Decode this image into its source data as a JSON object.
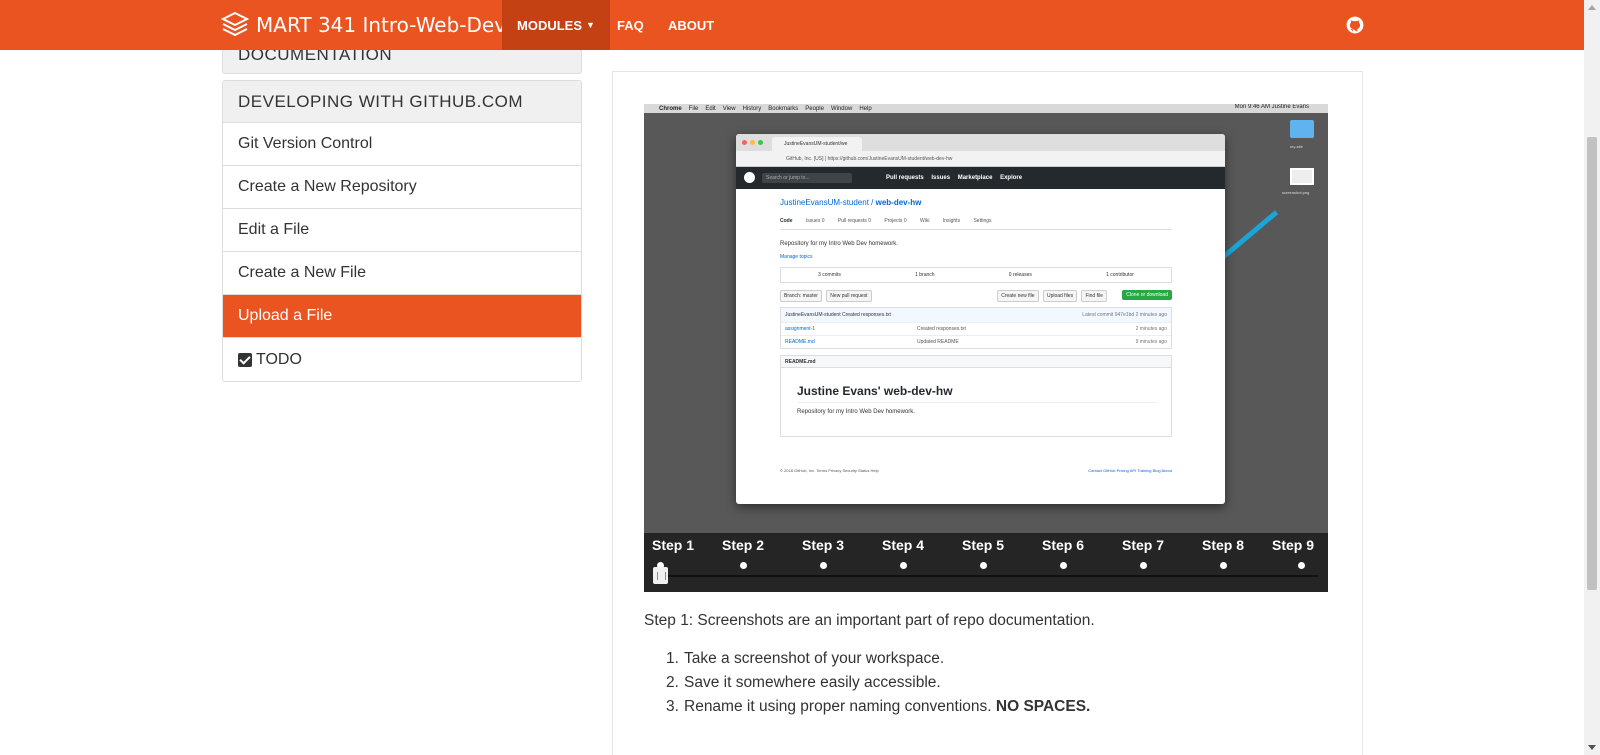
{
  "navbar": {
    "brand": "MART 341 Intro-Web-Dev",
    "modules": "MODULES",
    "faq": "FAQ",
    "about": "ABOUT"
  },
  "sidebar": {
    "top_section": "DOCUMENTATION",
    "heading": "DEVELOPING WITH GITHUB.COM",
    "items": [
      {
        "label": "Git Version Control"
      },
      {
        "label": "Create a New Repository"
      },
      {
        "label": "Edit a File"
      },
      {
        "label": "Create a New File"
      },
      {
        "label": "Upload a File"
      },
      {
        "label": "TODO"
      }
    ]
  },
  "slide": {
    "mac_menu": [
      "Chrome",
      "File",
      "Edit",
      "View",
      "History",
      "Bookmarks",
      "People",
      "Window",
      "Help"
    ],
    "mac_right": "Mon 9:46 AM  Justine Evans",
    "desk_folder": "my-site",
    "desk_file": "screenshot.png",
    "tab_title": "JustineEvansUM-student/we",
    "url": "GitHub, Inc. [US] | https://github.com/JustineEvansUM-student/web-dev-hw",
    "gh_search": "Search or jump to...",
    "gh_links": [
      "Pull requests",
      "Issues",
      "Marketplace",
      "Explore"
    ],
    "repo_owner": "JustineEvansUM-student",
    "repo_name": "web-dev-hw",
    "repo_tabs": [
      "Code",
      "Issues 0",
      "Pull requests 0",
      "Projects 0",
      "Wiki",
      "Insights",
      "Settings"
    ],
    "repo_desc": "Repository for my Intro Web Dev homework.",
    "manage_topics": "Manage topics",
    "stats": [
      "3 commits",
      "1 branch",
      "0 releases",
      "1 contributor"
    ],
    "branch": "Branch: master",
    "new_pr": "New pull request",
    "file_btns": [
      "Create new file",
      "Upload files",
      "Find file"
    ],
    "clone": "Clone or download",
    "commit_head": "JustineEvansUM-student Created responses.txt",
    "latest_commit": "Latest commit 947e1bd 2 minutes ago",
    "files": [
      {
        "name": "assignment-1",
        "msg": "Created responses.txt",
        "time": "2 minutes ago"
      },
      {
        "name": "README.md",
        "msg": "Updated README",
        "time": "9 minutes ago"
      }
    ],
    "readme_label": "README.md",
    "readme_title": "Justine Evans' web-dev-hw",
    "readme_body": "Repository for my Intro Web Dev homework.",
    "footer_left": "© 2018 GitHub, Inc.  Terms  Privacy  Security  Status  Help",
    "footer_right": "Contact GitHub  Pricing  API  Training  Blog  About"
  },
  "stepper": {
    "steps": [
      "Step 1",
      "Step 2",
      "Step 3",
      "Step 4",
      "Step 5",
      "Step 6",
      "Step 7",
      "Step 8",
      "Step 9"
    ],
    "current_step": 1
  },
  "content": {
    "caption": "Step 1: Screenshots are an important part of repo documentation.",
    "list": [
      {
        "num": "1.",
        "text": "Take a screenshot of your workspace."
      },
      {
        "num": "2.",
        "text": "Save it somewhere easily accessible."
      },
      {
        "num": "3.",
        "text": "Rename it using proper naming conventions. ",
        "bold": "NO SPACES."
      }
    ]
  },
  "colors": {
    "brand": "#e95420",
    "brand_dark": "#c34113"
  },
  "icons": {
    "brand_logo": "stack-layers-icon",
    "github": "github-octocat-icon",
    "todo": "checkbox-checked-icon"
  }
}
